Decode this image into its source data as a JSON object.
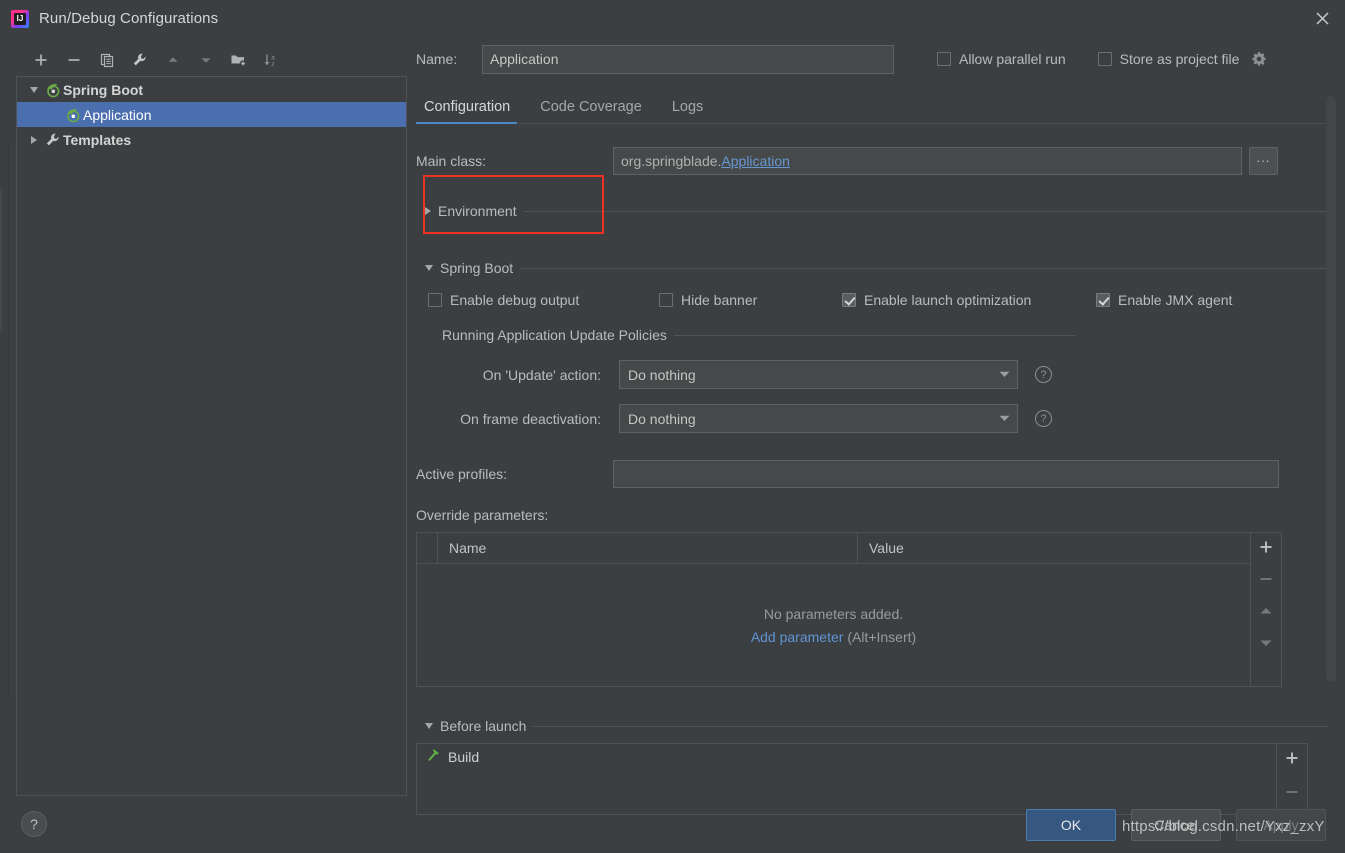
{
  "window": {
    "title": "Run/Debug Configurations",
    "app_icon": "intellij-idea-icon",
    "close_icon": "close-icon"
  },
  "left_panel": {
    "toolbar": [
      {
        "name": "add-configuration-button",
        "icon": "plus-icon"
      },
      {
        "name": "remove-configuration-button",
        "icon": "minus-icon"
      },
      {
        "name": "copy-configuration-button",
        "icon": "copy-icon"
      },
      {
        "name": "edit-templates-button",
        "icon": "wrench-icon"
      },
      {
        "name": "move-up-button",
        "icon": "arrow-up-icon"
      },
      {
        "name": "move-down-button",
        "icon": "arrow-down-icon"
      },
      {
        "name": "new-folder-button",
        "icon": "new-folder-icon"
      },
      {
        "name": "sort-configurations-button",
        "icon": "sort-az-icon"
      }
    ],
    "tree": [
      {
        "label": "Spring Boot",
        "icon": "spring-boot-icon",
        "expanded": true,
        "selected": false,
        "level": 0
      },
      {
        "label": "Application",
        "icon": "spring-boot-icon",
        "expanded": null,
        "selected": true,
        "level": 1
      },
      {
        "label": "Templates",
        "icon": "wrench-icon",
        "expanded": false,
        "selected": false,
        "level": 0
      }
    ]
  },
  "header": {
    "name_label": "Name:",
    "name_value": "Application",
    "name_placeholder": "Name",
    "allow_parallel_run": {
      "label": "Allow parallel run",
      "checked": false
    },
    "store_as_project_file": {
      "label": "Store as project file",
      "checked": false
    },
    "gear_icon": "gear-icon"
  },
  "tabs": [
    {
      "label": "Configuration",
      "active": true
    },
    {
      "label": "Code Coverage",
      "active": false
    },
    {
      "label": "Logs",
      "active": false
    }
  ],
  "configuration": {
    "main_class": {
      "label": "Main class:",
      "prefix": "org.springblade.",
      "link": "Application",
      "browse_button": "..."
    },
    "environment_group": {
      "label": "Environment",
      "expanded": false
    },
    "spring_boot_group": {
      "label": "Spring Boot",
      "expanded": true
    },
    "checkboxes": [
      {
        "label": "Enable debug output",
        "checked": false
      },
      {
        "label": "Hide banner",
        "checked": false
      },
      {
        "label": "Enable launch optimization",
        "checked": true
      },
      {
        "label": "Enable JMX agent",
        "checked": true
      }
    ],
    "update_policies_group": {
      "label": "Running Application Update Policies"
    },
    "on_update_action": {
      "label": "On 'Update' action:",
      "value": "Do nothing",
      "help": "?"
    },
    "on_frame_deactivation": {
      "label": "On frame deactivation:",
      "value": "Do nothing",
      "help": "?"
    },
    "active_profiles": {
      "label": "Active profiles:",
      "value": "",
      "placeholder": ""
    },
    "override_parameters": {
      "label": "Override parameters:",
      "columns": [
        "Name",
        "Value"
      ],
      "rows": [],
      "empty_text": "No parameters added.",
      "add_link": "Add parameter",
      "add_shortcut": "(Alt+Insert)",
      "side_buttons": [
        {
          "name": "add-parameter-button",
          "icon": "plus-icon"
        },
        {
          "name": "remove-parameter-button",
          "icon": "minus-icon"
        },
        {
          "name": "move-parameter-up-button",
          "icon": "arrow-up-icon"
        },
        {
          "name": "move-parameter-down-button",
          "icon": "arrow-down-icon"
        }
      ]
    },
    "before_launch": {
      "group_label": "Before launch",
      "expanded": true,
      "items": [
        {
          "label": "Build",
          "icon": "build-hammer-icon"
        }
      ],
      "side_buttons": [
        {
          "name": "add-before-launch-task-button",
          "icon": "plus-icon"
        },
        {
          "name": "remove-before-launch-task-button",
          "icon": "minus-icon"
        }
      ]
    }
  },
  "footer": {
    "help_button": "?",
    "ok_label": "OK",
    "cancel_label": "Cancel",
    "apply_label": "Apply",
    "apply_enabled": false
  },
  "watermark": "https://blog.csdn.net/Yxz_zxY",
  "colors": {
    "background": "#3c3f41",
    "selection_blue": "#4b6eaf",
    "link_blue": "#6897d0",
    "tab_underline": "#4a88c7",
    "ok_button": "#365880",
    "annotation_red": "#ee3124",
    "spring_green": "#6aab48"
  }
}
